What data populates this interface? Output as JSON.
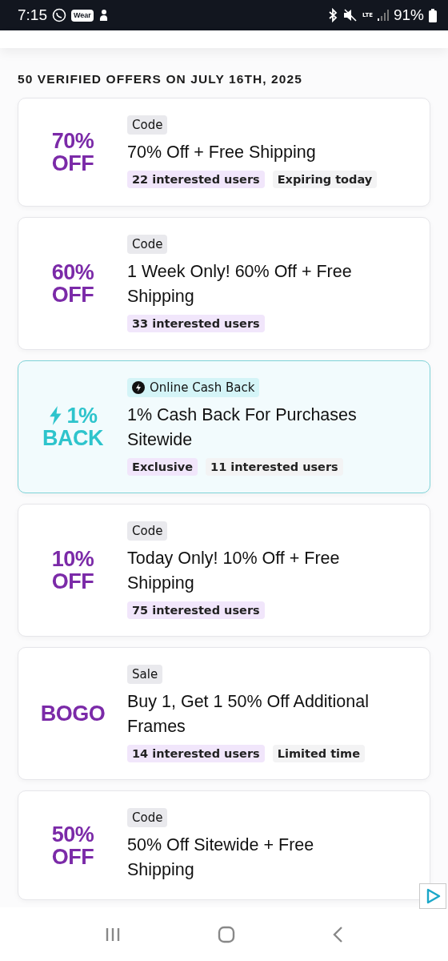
{
  "status_bar": {
    "time": "7:15",
    "wear_label": "Wear",
    "network": "LTE",
    "battery": "91%"
  },
  "heading": "50 VERIFIED OFFERS ON JULY 16TH, 2025",
  "offers": [
    {
      "kind": "coupon",
      "value_lines": [
        "70%",
        "OFF"
      ],
      "type": "Code",
      "title": "70% Off + Free Shipping",
      "tags": [
        {
          "text": "22 interested users",
          "kind": "highlight"
        },
        {
          "text": "Expiring today",
          "kind": "plain"
        }
      ]
    },
    {
      "kind": "coupon",
      "value_lines": [
        "60%",
        "OFF"
      ],
      "type": "Code",
      "title": "1 Week Only! 60% Off + Free Shipping",
      "tags": [
        {
          "text": "33 interested users",
          "kind": "highlight"
        }
      ]
    },
    {
      "kind": "cashback",
      "value_lines": [
        "1%",
        "BACK"
      ],
      "type": "Online Cash Back",
      "title": "1% Cash Back For Purchases Sitewide",
      "tags": [
        {
          "text": "Exclusive",
          "kind": "highlight"
        },
        {
          "text": "11 interested users",
          "kind": "plain"
        }
      ]
    },
    {
      "kind": "coupon",
      "value_lines": [
        "10%",
        "OFF"
      ],
      "type": "Code",
      "title": "Today Only! 10% Off + Free Shipping",
      "tags": [
        {
          "text": "75 interested users",
          "kind": "highlight"
        }
      ]
    },
    {
      "kind": "coupon",
      "value_lines": [
        "BOGO"
      ],
      "type": "Sale",
      "title": "Buy 1, Get 1 50% Off Additional Frames",
      "tags": [
        {
          "text": "14 interested users",
          "kind": "highlight"
        },
        {
          "text": "Limited time",
          "kind": "plain"
        }
      ]
    },
    {
      "kind": "coupon",
      "value_lines": [
        "50%",
        "OFF"
      ],
      "type": "Code",
      "title": "50% Off Sitewide + Free Shipping"
    }
  ]
}
